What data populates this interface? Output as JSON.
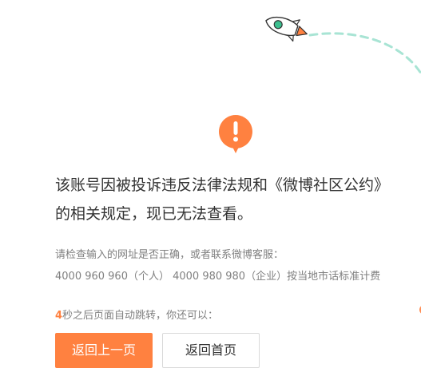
{
  "error": {
    "headline_line1": "该账号因被投诉违反法律法规和《微博社区公约》",
    "headline_line2": "的相关规定，现已无法查看。",
    "help_line1": "请检查输入的网址是否正确，或者联系微博客服：",
    "help_line2": "4000 960 960（个人） 4000 980 980（企业）按当地市话标准计费"
  },
  "redirect": {
    "seconds": "4",
    "text": "秒之后页面自动跳转，你还可以："
  },
  "actions": {
    "back_label": "返回上一页",
    "home_label": "返回首页"
  },
  "icons": {
    "alert": "exclamation-icon",
    "rocket": "rocket-icon"
  },
  "colors": {
    "accent": "#ff8140",
    "dash_trail": "#a8e4d4",
    "text_primary": "#333333",
    "text_secondary": "#808080"
  }
}
